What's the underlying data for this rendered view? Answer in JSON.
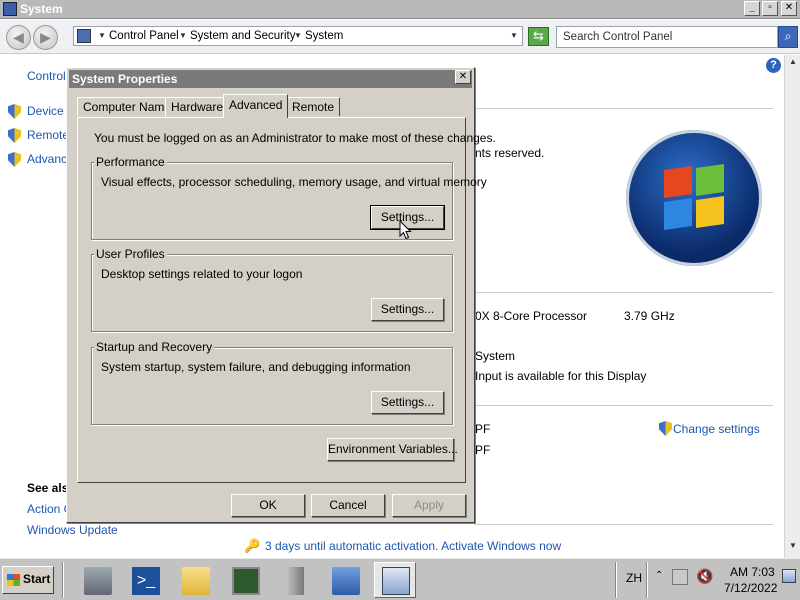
{
  "window": {
    "title": "System",
    "min_label": "_",
    "max_label": "▫",
    "close_label": "✕"
  },
  "toolbar": {
    "back_glyph": "◀",
    "forward_glyph": "▶",
    "breadcrumbs": [
      "Control Panel",
      "System and Security",
      "System"
    ],
    "refresh_glyph": "⇆",
    "search_placeholder": "Search Control Panel",
    "search_glyph": "⌕"
  },
  "sidebar": {
    "home": "Control",
    "links": [
      "Device M",
      "Remote",
      "Advance"
    ],
    "see_also": "See als",
    "see_also_links": [
      "Action C",
      "Windows Update"
    ]
  },
  "main": {
    "rights": "nts reserved.",
    "processor": "0X 8-Core Processor",
    "speed": "3.79 GHz",
    "system_type": "System",
    "pen_touch": "Input is available for this Display",
    "pf1": "PF",
    "pf2": "PF",
    "change_settings": "Change settings",
    "activation": "3 days until automatic activation. Activate Windows now",
    "help_glyph": "?"
  },
  "dialog": {
    "title": "System Properties",
    "close_glyph": "✕",
    "tabs": [
      "Computer Name",
      "Hardware",
      "Advanced",
      "Remote"
    ],
    "active_tab": "Advanced",
    "admin_note": "You must be logged on as an Administrator to make most of these changes.",
    "groups": [
      {
        "title": "Performance",
        "desc": "Visual effects, processor scheduling, memory usage, and virtual memory",
        "button": "Settings..."
      },
      {
        "title": "User Profiles",
        "desc": "Desktop settings related to your logon",
        "button": "Settings..."
      },
      {
        "title": "Startup and Recovery",
        "desc": "System startup, system failure, and debugging information",
        "button": "Settings..."
      }
    ],
    "env_button": "Environment Variables...",
    "ok": "OK",
    "cancel": "Cancel",
    "apply": "Apply"
  },
  "taskbar": {
    "start": "Start",
    "apps": [
      "server-manager-icon",
      "powershell-icon",
      "explorer-icon",
      "task-manager-icon",
      "tower-icon",
      "control-panel-icon",
      "system-properties-icon"
    ],
    "lang": "ZH",
    "time": "AM 7:03",
    "date": "7/12/2022"
  }
}
